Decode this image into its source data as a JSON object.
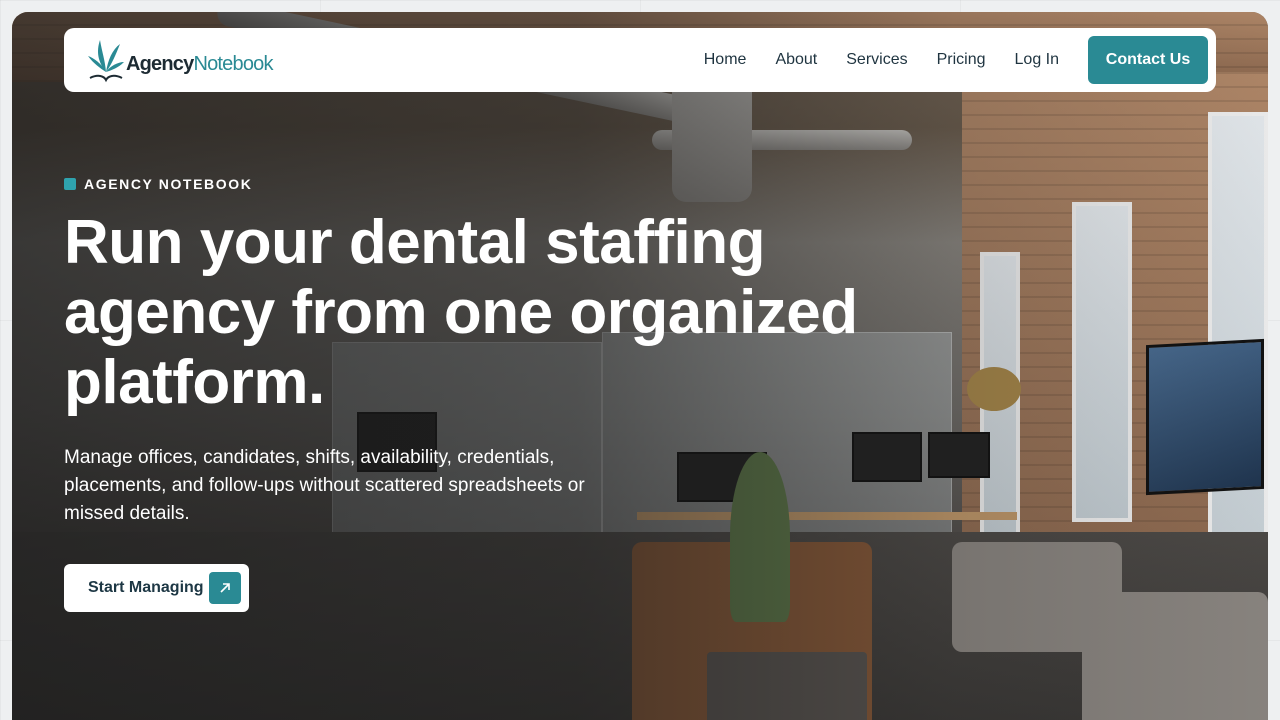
{
  "brand": {
    "name_part1": "Agency",
    "name_part2": "Notebook",
    "accent": "#2a8a94",
    "dark": "#1d2b33"
  },
  "nav": {
    "items": [
      {
        "label": "Home"
      },
      {
        "label": "About"
      },
      {
        "label": "Services"
      },
      {
        "label": "Pricing"
      },
      {
        "label": "Log In"
      }
    ],
    "cta_label": "Contact Us"
  },
  "hero": {
    "eyebrow": "AGENCY NOTEBOOK",
    "headline": "Run your dental staffing agency from one organized platform.",
    "subtext": "Manage offices, candidates, shifts, availability, credentials, placements, and follow-ups without scattered spreadsheets or missed details.",
    "cta_label": "Start Managing",
    "cta_icon": "arrow-up-right-icon",
    "background": "office-photo"
  }
}
